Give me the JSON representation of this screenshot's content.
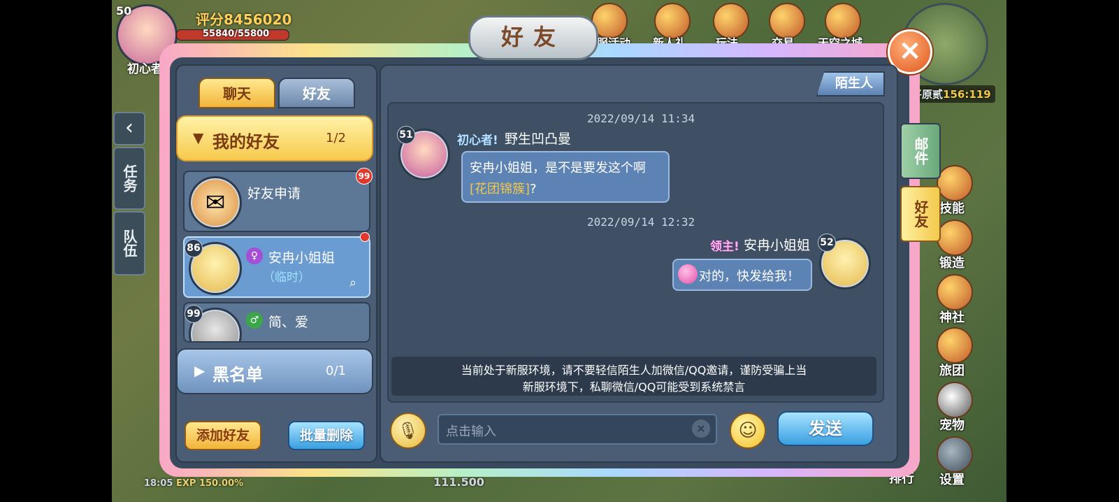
{
  "hud": {
    "player_level": "50",
    "player_name": "初心者",
    "score_label": "评分",
    "score_value": "8456020",
    "hp_text": "55840/55800",
    "top_menu": [
      "开服活动",
      "新人礼",
      "玩法",
      "交易",
      "天空之城"
    ],
    "map_coords_label": "平原贰",
    "map_coords": "156:119",
    "left_tabs": [
      "任务",
      "队伍"
    ],
    "right_menu": [
      "技能",
      "锻造",
      "神社",
      "旅团",
      "宠物",
      "排行",
      "设置"
    ],
    "battery_time": "18:05",
    "exp_text": "EXP 150.00%",
    "bottom_value": "111.500"
  },
  "dialog": {
    "title": "好友",
    "close_label": "×",
    "tabs": [
      "聊天",
      "好友"
    ],
    "side_tabs": [
      "邮件",
      "好友"
    ],
    "stranger_tag": "陌生人"
  },
  "friends_panel": {
    "group_mine": {
      "label": "我的好友",
      "count": "1/2"
    },
    "friend_request": {
      "label": "好友申请",
      "badge": "99"
    },
    "friends": [
      {
        "level": "86",
        "name": "安冉小姐姐",
        "sub": "（临时）",
        "selected": true
      },
      {
        "level": "99",
        "name": "简、爱",
        "sub": "",
        "selected": false
      }
    ],
    "group_block": {
      "label": "黑名单",
      "count": "0/1"
    },
    "add_button": "添加好友",
    "batch_delete_button": "批量删除"
  },
  "chat": {
    "messages": [
      {
        "time": "2022/09/14 11:34",
        "level": "51",
        "title_badge": "初心者!",
        "sender": "野生凹凸曼",
        "text": "安冉小姐姐，是不是要发这个啊",
        "item_link": "[花团锦簇]",
        "suffix": "?",
        "side": "left"
      },
      {
        "time": "2022/09/14 12:32",
        "level": "52",
        "title_badge": "领主!",
        "sender": "安冉小姐姐",
        "text": "对的，快发给我！",
        "side": "right"
      }
    ],
    "notice_line1": "当前处于新服环境，请不要轻信陌生人加微信/QQ邀请，谨防受骗上当",
    "notice_line2": "新服环境下，私聊微信/QQ可能受到系统禁言",
    "input_placeholder": "点击输入",
    "send_button": "发送"
  },
  "colors": {
    "panel": "#4a5d74",
    "gold": "#f2b53b",
    "link": "#f2c94c",
    "blue_button": "#3a9fe0"
  }
}
